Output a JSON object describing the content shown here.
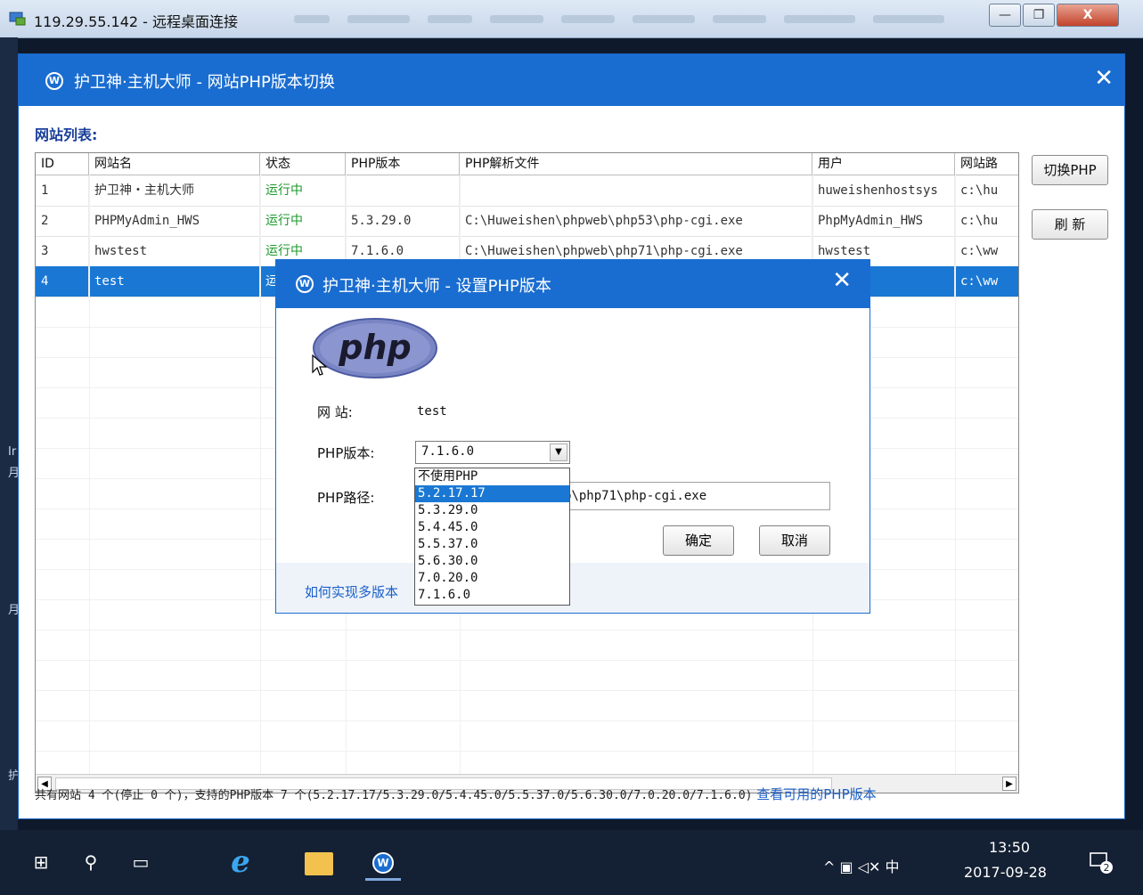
{
  "rdp": {
    "title": "119.29.55.142 - 远程桌面连接",
    "minimize": "—",
    "restore": "❐",
    "close": "X"
  },
  "desktop": {
    "side_chars": [
      "Ir",
      "月",
      "月",
      "护"
    ]
  },
  "main_window": {
    "title": "护卫神·主机大师 - 网站PHP版本切换",
    "close": "✕",
    "site_list_label": "网站列表:",
    "columns": [
      "ID",
      "网站名",
      "状态",
      "PHP版本",
      "PHP解析文件",
      "用户",
      "网站路"
    ],
    "rows": [
      {
        "id": "1",
        "name": "护卫神・主机大师",
        "status": "运行中",
        "php_version": "",
        "php_file": "",
        "user": "huweishenhostsys",
        "path": "c:\\hu"
      },
      {
        "id": "2",
        "name": "PHPMyAdmin_HWS",
        "status": "运行中",
        "php_version": "5.3.29.0",
        "php_file": "C:\\Huweishen\\phpweb\\php53\\php-cgi.exe",
        "user": "PhpMyAdmin_HWS",
        "path": "c:\\hu"
      },
      {
        "id": "3",
        "name": "hwstest",
        "status": "运行中",
        "php_version": "7.1.6.0",
        "php_file": "C:\\Huweishen\\phpweb\\php71\\php-cgi.exe",
        "user": "hwstest",
        "path": "c:\\ww"
      },
      {
        "id": "4",
        "name": "test",
        "status": "运",
        "php_version": "",
        "php_file": "",
        "user": "",
        "path": "c:\\ww"
      }
    ],
    "buttons": {
      "switch_php": "切换PHP",
      "refresh": "刷 新"
    },
    "status": {
      "text": "共有网站 4 个(停止 0 个)，支持的PHP版本 7 个(5.2.17.17/5.3.29.0/5.4.45.0/5.5.37.0/5.6.30.0/7.0.20.0/7.1.6.0)",
      "link": "查看可用的PHP版本"
    }
  },
  "dialog": {
    "title": "护卫神·主机大师 - 设置PHP版本",
    "close": "✕",
    "logo_text": "php",
    "site_label": "网 站:",
    "site_value": "test",
    "version_label": "PHP版本:",
    "version_value": "7.1.6.0",
    "path_label": "PHP路径:",
    "path_value": "b\\php71\\php-cgi.exe",
    "ok": "确定",
    "cancel": "取消",
    "howto_link": "如何实现多版本",
    "dropdown_options": [
      "不使用PHP",
      "5.2.17.17",
      "5.3.29.0",
      "5.4.45.0",
      "5.5.37.0",
      "5.6.30.0",
      "7.0.20.0",
      "7.1.6.0"
    ],
    "highlighted_option": "5.2.17.17"
  },
  "taskbar": {
    "windows_icon": "⊞",
    "search_icon": "⚲",
    "taskview_icon": "▭",
    "ie_icon": "e",
    "hws_icon": "W",
    "tray": "^ ▣ ◁✕ 中",
    "time": "13:50",
    "date": "2017-09-28",
    "notification_badge": "2"
  },
  "colors": {
    "accent": "#1a6dd0",
    "running": "#1b9a2b",
    "selected_row": "#1a78d4",
    "link": "#1a5fc8"
  }
}
